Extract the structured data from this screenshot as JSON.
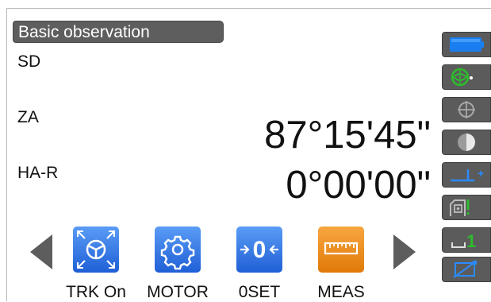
{
  "title": "Basic observation",
  "measurements": {
    "sd_label": "SD",
    "sd_value": "",
    "za_label": "ZA",
    "za_value": "87°15'45\"",
    "ha_label": "HA-R",
    "ha_value": "0°00'00\""
  },
  "function_keys": [
    {
      "label": "TRK On",
      "icon": "tracking-icon"
    },
    {
      "label": "MOTOR",
      "icon": "gear-icon"
    },
    {
      "label": "0SET",
      "icon": "zero-set-icon"
    },
    {
      "label": "MEAS",
      "icon": "ruler-icon"
    }
  ],
  "side_panel": {
    "target_index": "1",
    "icons": [
      "battery-icon",
      "target-circle-icon",
      "crosshair-icon",
      "half-circle-icon",
      "instrument-height-icon",
      "prism-icon",
      "target-number-icon",
      "laser-icon"
    ]
  },
  "colors": {
    "fkey_blue": "#2f6fe0",
    "fkey_orange": "#ef8a12",
    "side_button": "#5b5b5b",
    "battery": "#1a7ef0",
    "accent_green": "#2dbb2d"
  }
}
